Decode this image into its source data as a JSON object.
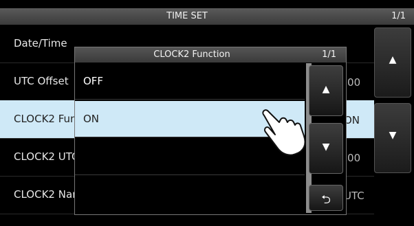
{
  "header": {
    "title": "TIME SET",
    "page": "1/1"
  },
  "menu_rows": [
    {
      "label": "Date/Time",
      "value": ""
    },
    {
      "label": "UTC Offset",
      "value": ":00"
    },
    {
      "label": "CLOCK2 Function",
      "value": "ON"
    },
    {
      "label": "CLOCK2 UTC Offset",
      "value": ":00"
    },
    {
      "label": "CLOCK2 Name",
      "value": "UTC"
    }
  ],
  "side_buttons": {
    "up": "▲",
    "down": "▼"
  },
  "dialog": {
    "title": "CLOCK2 Function",
    "page": "1/1",
    "options": [
      "OFF",
      "ON"
    ],
    "selected": "ON",
    "up": "▲",
    "down": "▼",
    "back": "⮌"
  }
}
